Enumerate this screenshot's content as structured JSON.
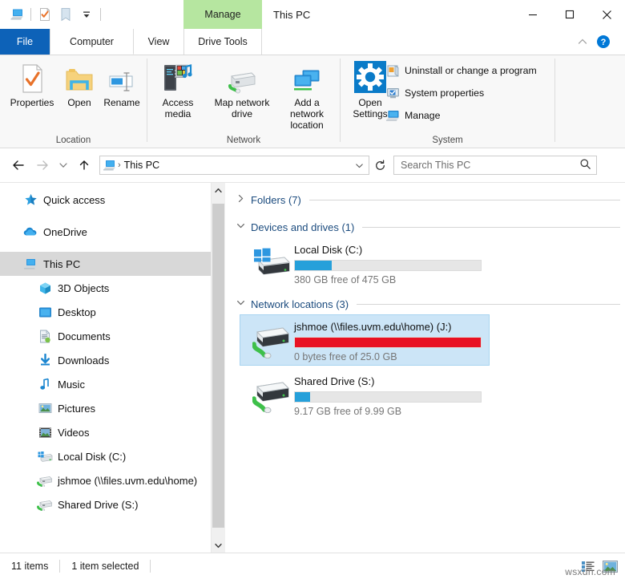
{
  "window": {
    "title": "This PC",
    "contextual_tab_group": "Manage",
    "quick_access": [
      {
        "name": "this-pc-icon",
        "label": "This PC"
      },
      {
        "name": "properties-icon",
        "label": "Properties"
      },
      {
        "name": "new-folder-icon",
        "label": "New folder"
      },
      {
        "name": "customize-qat-icon",
        "label": "Customize Quick Access Toolbar"
      }
    ],
    "controls": {
      "minimize": "Minimize",
      "maximize": "Maximize",
      "close": "Close",
      "collapse_ribbon": "Collapse the Ribbon",
      "help": "Help"
    }
  },
  "tabs": [
    {
      "label": "File",
      "active": false,
      "style": "file"
    },
    {
      "label": "Computer",
      "active": true,
      "style": "normal"
    },
    {
      "label": "View",
      "active": false,
      "style": "normal"
    },
    {
      "label": "Drive Tools",
      "active": false,
      "style": "contextual"
    }
  ],
  "ribbon": {
    "groups": [
      {
        "label": "Location",
        "buttons": [
          {
            "label": "Properties",
            "icon": "properties-icon",
            "dropdown": false
          },
          {
            "label": "Open",
            "icon": "open-folder-icon",
            "dropdown": false
          },
          {
            "label": "Rename",
            "icon": "rename-icon",
            "dropdown": false
          }
        ]
      },
      {
        "label": "Network",
        "buttons": [
          {
            "label": "Access media",
            "icon": "access-media-icon",
            "dropdown": true
          },
          {
            "label": "Map network drive",
            "icon": "map-network-drive-icon",
            "dropdown": true
          },
          {
            "label": "Add a network location",
            "icon": "add-network-location-icon",
            "dropdown": false
          }
        ]
      },
      {
        "label": "System",
        "buttons": [
          {
            "label": "Open Settings",
            "icon": "settings-gear-icon",
            "dropdown": false
          }
        ],
        "small_buttons": [
          {
            "label": "Uninstall or change a program",
            "icon": "uninstall-program-icon"
          },
          {
            "label": "System properties",
            "icon": "system-properties-icon"
          },
          {
            "label": "Manage",
            "icon": "manage-computer-icon"
          }
        ]
      }
    ]
  },
  "addressbar": {
    "back": "Back",
    "forward": "Forward",
    "recent": "Recent locations",
    "up": "Up",
    "path_icon": "this-pc-icon",
    "path_separator": "›",
    "path_text": "This PC",
    "dropdown": "Previous locations",
    "refresh": "Refresh",
    "search_placeholder": "Search This PC",
    "search_value": "",
    "search_icon": "search-icon"
  },
  "navpane": {
    "items": [
      {
        "label": "Quick access",
        "icon": "star-icon",
        "indent": false,
        "selected": false,
        "gap_after": true
      },
      {
        "label": "OneDrive",
        "icon": "onedrive-cloud-icon",
        "indent": false,
        "selected": false,
        "gap_after": true
      },
      {
        "label": "This PC",
        "icon": "this-pc-icon",
        "indent": false,
        "selected": true,
        "gap_after": false
      },
      {
        "label": "3D Objects",
        "icon": "3d-objects-icon",
        "indent": true,
        "selected": false,
        "gap_after": false
      },
      {
        "label": "Desktop",
        "icon": "desktop-icon",
        "indent": true,
        "selected": false,
        "gap_after": false
      },
      {
        "label": "Documents",
        "icon": "documents-icon",
        "indent": true,
        "selected": false,
        "gap_after": false
      },
      {
        "label": "Downloads",
        "icon": "downloads-icon",
        "indent": true,
        "selected": false,
        "gap_after": false
      },
      {
        "label": "Music",
        "icon": "music-icon",
        "indent": true,
        "selected": false,
        "gap_after": false
      },
      {
        "label": "Pictures",
        "icon": "pictures-icon",
        "indent": true,
        "selected": false,
        "gap_after": false
      },
      {
        "label": "Videos",
        "icon": "videos-icon",
        "indent": true,
        "selected": false,
        "gap_after": false
      },
      {
        "label": "Local Disk (C:)",
        "icon": "local-disk-icon",
        "indent": true,
        "selected": false,
        "gap_after": false
      },
      {
        "label": "jshmoe (\\\\files.uvm.edu\\home)",
        "icon": "network-drive-icon",
        "indent": true,
        "selected": false,
        "gap_after": false
      },
      {
        "label": "Shared Drive (S:)",
        "icon": "network-drive-icon",
        "indent": true,
        "selected": false,
        "gap_after": false
      }
    ],
    "scrollbar": {
      "up": "Scroll up",
      "down": "Scroll down",
      "thumb": "Scroll thumb"
    }
  },
  "content": {
    "sections": [
      {
        "header": "Folders (7)",
        "expanded": false,
        "chevron": "›",
        "items": []
      },
      {
        "header": "Devices and drives (1)",
        "expanded": true,
        "chevron": "∨",
        "items": [
          {
            "name": "Local Disk (C:)",
            "icon": "windows-drive-icon",
            "free_text": "380 GB free of 475 GB",
            "used_percent": 20,
            "bar_color": "#26a0da",
            "selected": false
          }
        ]
      },
      {
        "header": "Network locations (3)",
        "expanded": true,
        "chevron": "∨",
        "items": [
          {
            "name": "jshmoe (\\\\files.uvm.edu\\home) (J:)",
            "icon": "network-drive-icon",
            "free_text": "0 bytes free of 25.0 GB",
            "used_percent": 100,
            "bar_color": "#e81123",
            "selected": true
          },
          {
            "name": "Shared Drive (S:)",
            "icon": "network-drive-icon",
            "free_text": "9.17 GB free of 9.99 GB",
            "used_percent": 8,
            "bar_color": "#26a0da",
            "selected": false
          }
        ]
      }
    ]
  },
  "statusbar": {
    "item_count": "11 items",
    "selection": "1 item selected",
    "views": [
      {
        "name": "details-view-icon",
        "label": "Details view"
      },
      {
        "name": "large-icons-view-icon",
        "label": "Large icons view"
      }
    ],
    "watermark": "wsxdn.com"
  },
  "colors": {
    "file_tab_blue": "#0d62b8",
    "contextual_green": "#b6e6a0",
    "selection_blue": "#cce5f7",
    "nav_selection_gray": "#d8d8d8",
    "progress_blue": "#26a0da",
    "progress_red": "#e81123",
    "group_header_blue": "#1b4b7e"
  }
}
